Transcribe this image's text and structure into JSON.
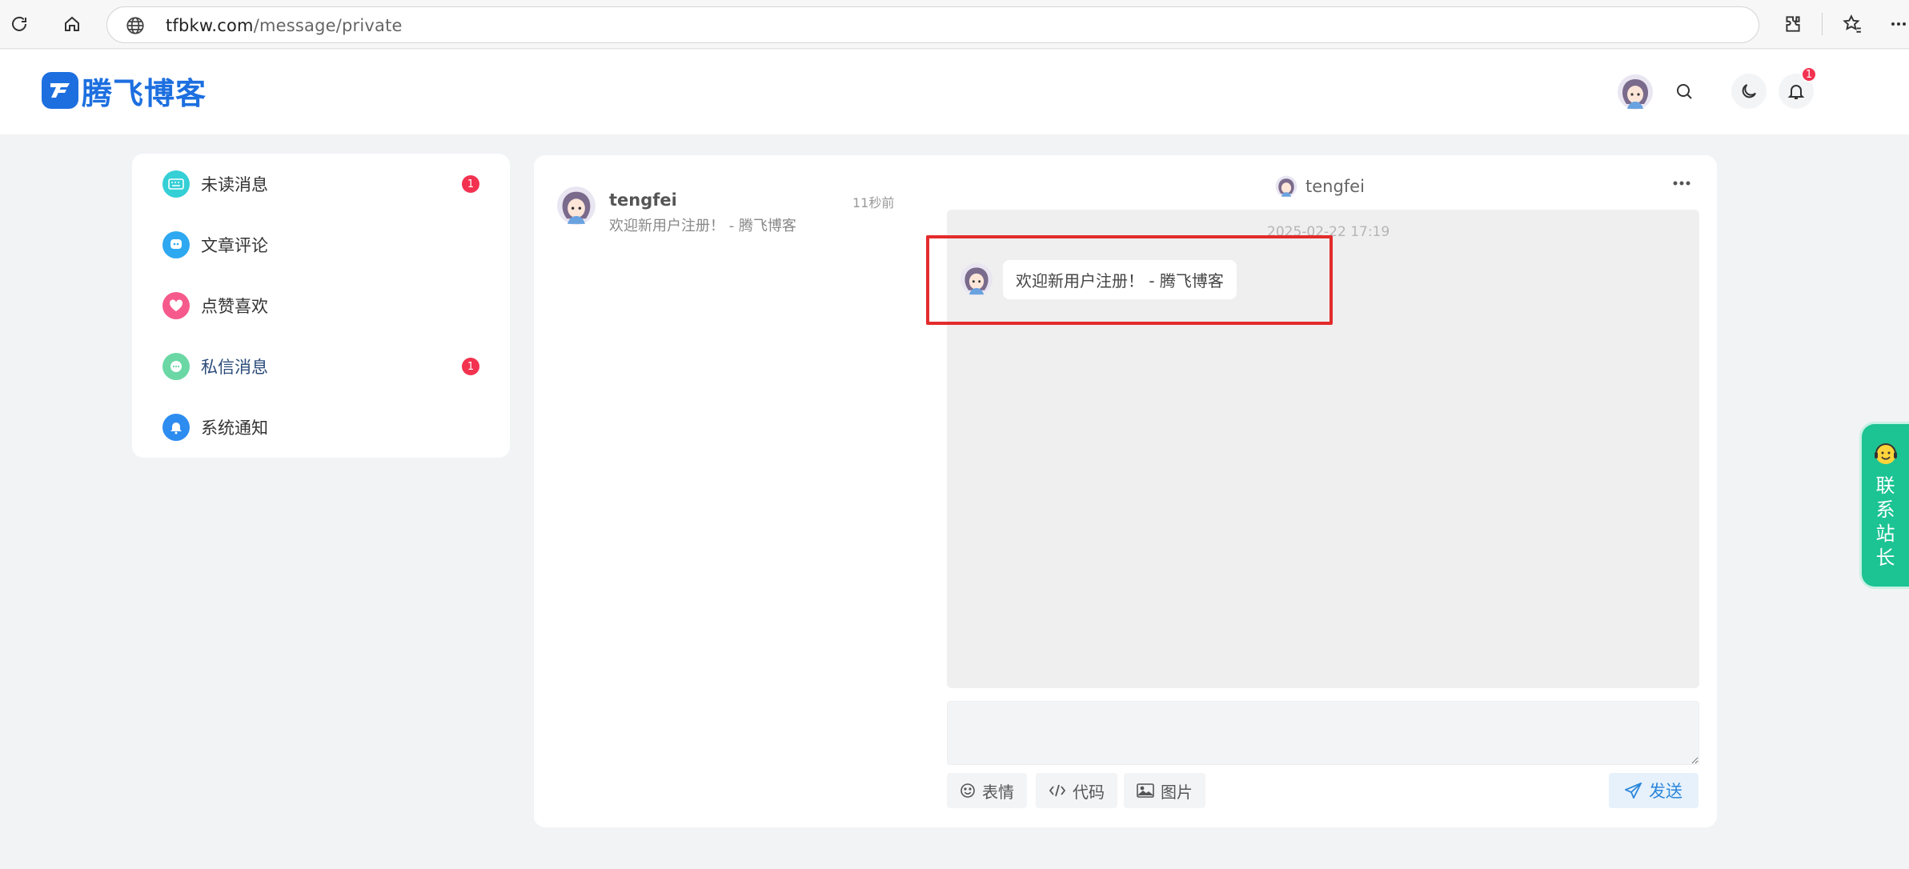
{
  "browser": {
    "url_host": "tfbkw.com",
    "url_path": "/message/private"
  },
  "header": {
    "logo_text": "腾飞博客",
    "notification_count": "1"
  },
  "sidebar": {
    "items": [
      {
        "label": "未读消息",
        "icon": "unread-icon",
        "color": "#35cfd6",
        "badge": "1"
      },
      {
        "label": "文章评论",
        "icon": "comment-icon",
        "color": "#2ea8f0",
        "badge": ""
      },
      {
        "label": "点赞喜欢",
        "icon": "heart-icon",
        "color": "#f65a8c",
        "badge": ""
      },
      {
        "label": "私信消息",
        "icon": "chat-icon",
        "color": "#6ad7a4",
        "badge": "1"
      },
      {
        "label": "系统通知",
        "icon": "bell-icon",
        "color": "#2d8cf0",
        "badge": ""
      }
    ]
  },
  "conversation": {
    "name": "tengfei",
    "time": "11秒前",
    "preview": "欢迎新用户注册！ - 腾飞博客"
  },
  "chat": {
    "header_name": "tengfei",
    "timestamp": "2025-02-22 17:19",
    "message": "欢迎新用户注册！ - 腾飞博客"
  },
  "composer": {
    "input_value": "",
    "emoji_label": "表情",
    "code_label": "代码",
    "image_label": "图片",
    "send_label": "发送"
  },
  "contact": {
    "label": "联系站长"
  },
  "colors": {
    "brand": "#1d6fe0",
    "badge": "#f2324f",
    "highlight": "#e32b2b",
    "contact": "#1cc393"
  }
}
